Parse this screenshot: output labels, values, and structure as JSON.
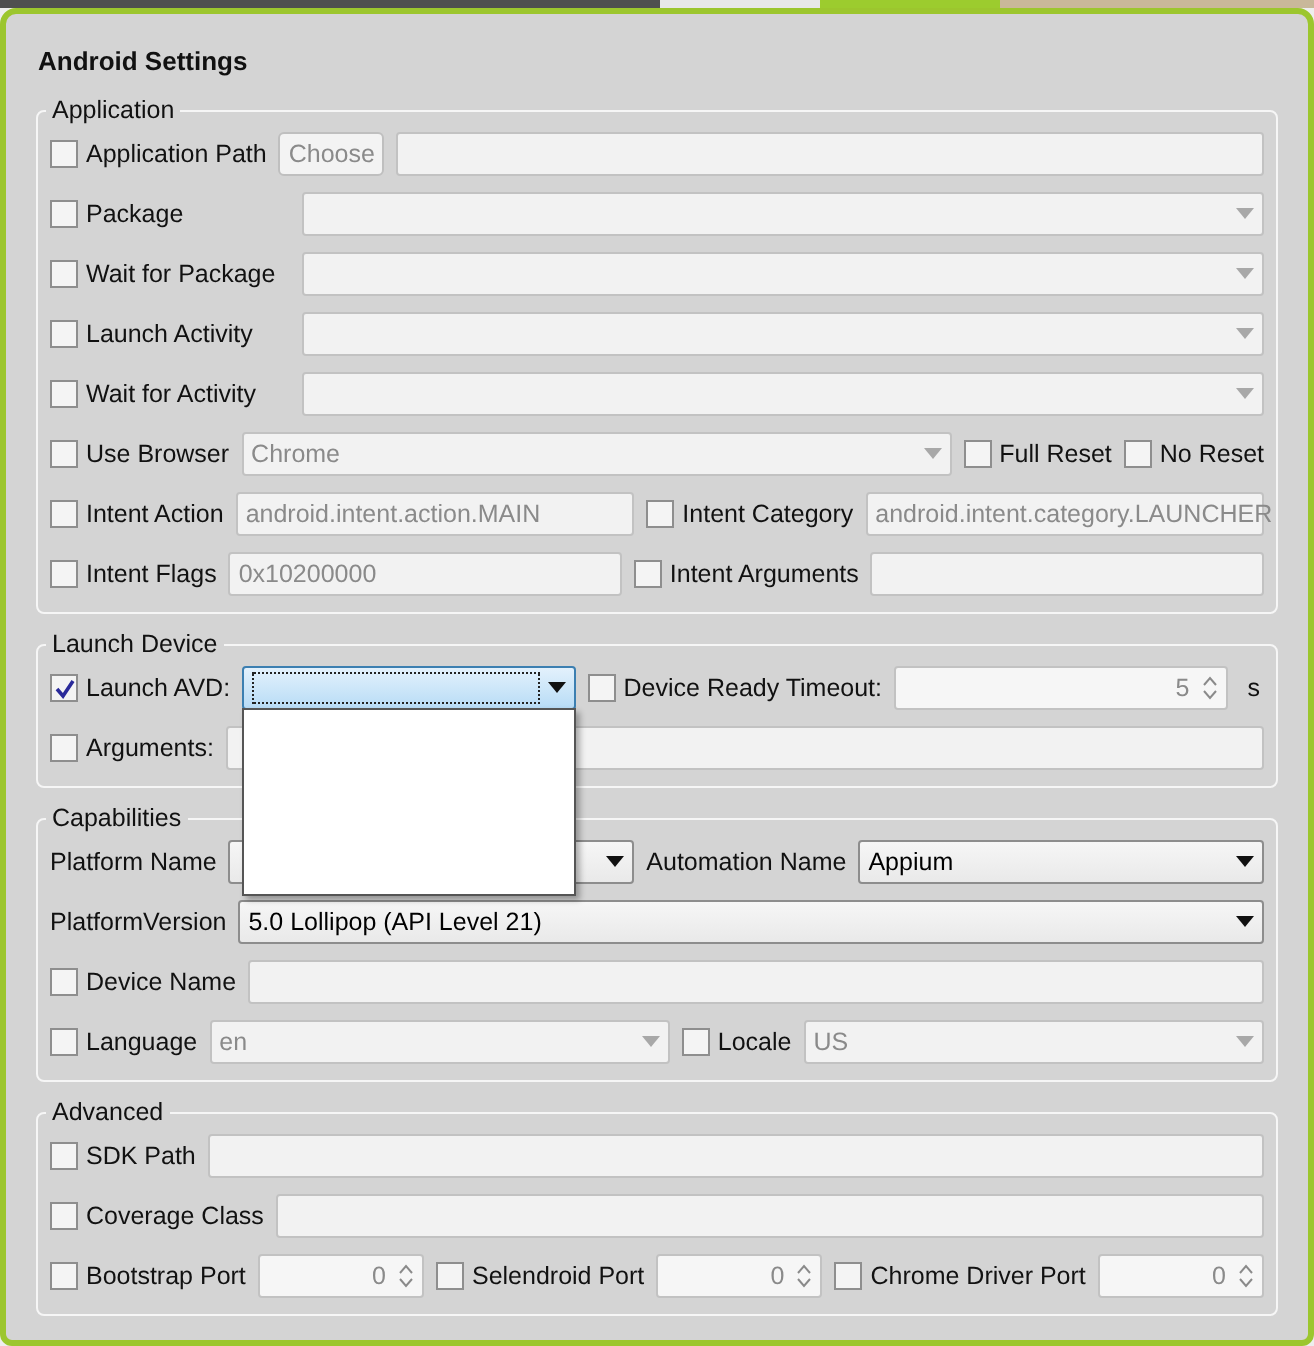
{
  "window": {
    "title": "Android Settings"
  },
  "sections": [
    {
      "title": "Application",
      "rows": [
        {
          "items": [
            {
              "kind": "checkbox",
              "label": "Application Path",
              "checked": false
            },
            {
              "kind": "button",
              "label": "Choose",
              "disabled": true
            },
            {
              "kind": "text",
              "disabled": true
            }
          ]
        },
        {
          "items": [
            {
              "kind": "checkbox",
              "label": "Package",
              "checked": false
            },
            {
              "kind": "combo",
              "disabled": true,
              "expanded": false
            }
          ]
        },
        {
          "items": [
            {
              "kind": "checkbox",
              "label": "Wait for Package",
              "checked": false
            },
            {
              "kind": "combo",
              "disabled": true,
              "expanded": false
            }
          ]
        },
        {
          "items": [
            {
              "kind": "checkbox",
              "label": "Launch Activity",
              "checked": false
            },
            {
              "kind": "combo",
              "disabled": true,
              "expanded": false
            }
          ]
        },
        {
          "items": [
            {
              "kind": "checkbox",
              "label": "Wait for Activity",
              "checked": false
            },
            {
              "kind": "combo",
              "disabled": true,
              "expanded": false
            }
          ]
        },
        {
          "items": [
            {
              "kind": "checkbox",
              "label": "Use Browser",
              "checked": false
            },
            {
              "kind": "combo",
              "value": "Chrome",
              "disabled": true,
              "expanded": false
            },
            {
              "kind": "checkbox",
              "label": "Full Reset",
              "checked": false
            },
            {
              "kind": "checkbox",
              "label": "No Reset",
              "checked": false
            }
          ]
        },
        {
          "items": [
            {
              "kind": "checkbox",
              "label": "Intent Action",
              "checked": false
            },
            {
              "kind": "text",
              "value": "android.intent.action.MAIN",
              "disabled": true
            },
            {
              "kind": "checkbox",
              "label": "Intent Category",
              "checked": false
            },
            {
              "kind": "text",
              "value": "android.intent.category.LAUNCHER",
              "disabled": true
            }
          ]
        },
        {
          "items": [
            {
              "kind": "checkbox",
              "label": "Intent Flags",
              "checked": false
            },
            {
              "kind": "text",
              "value": "0x10200000",
              "disabled": true
            },
            {
              "kind": "checkbox",
              "label": "Intent Arguments",
              "checked": false
            },
            {
              "kind": "text",
              "disabled": true
            }
          ]
        }
      ]
    },
    {
      "title": "Launch Device",
      "rows": [
        {
          "items": [
            {
              "kind": "checkbox",
              "label": "Launch AVD:",
              "checked": true
            },
            {
              "kind": "combo",
              "disabled": false,
              "expanded": true
            },
            {
              "kind": "checkbox",
              "label": "Device Ready Timeout:",
              "checked": false
            },
            {
              "kind": "spinner",
              "value": "5",
              "disabled": true
            },
            {
              "kind": "unit",
              "text": "s"
            }
          ]
        },
        {
          "items": [
            {
              "kind": "checkbox",
              "label": "Arguments:",
              "checked": false
            },
            {
              "kind": "text",
              "disabled": true
            }
          ]
        }
      ]
    },
    {
      "title": "Capabilities",
      "rows": [
        {
          "items": [
            {
              "kind": "label",
              "text": "Platform Name"
            },
            {
              "kind": "combo",
              "disabled": false,
              "expanded": false
            },
            {
              "kind": "label",
              "text": "Automation Name"
            },
            {
              "kind": "combo",
              "value": "Appium",
              "disabled": false,
              "expanded": false
            }
          ]
        },
        {
          "items": [
            {
              "kind": "label",
              "text": "PlatformVersion"
            },
            {
              "kind": "combo",
              "value": "5.0 Lollipop (API Level 21)",
              "disabled": false,
              "expanded": false
            }
          ]
        },
        {
          "items": [
            {
              "kind": "checkbox",
              "label": "Device Name",
              "checked": false
            },
            {
              "kind": "text",
              "disabled": true
            }
          ]
        },
        {
          "items": [
            {
              "kind": "checkbox",
              "label": "Language",
              "checked": false
            },
            {
              "kind": "combo",
              "value": "en",
              "disabled": true,
              "expanded": false
            },
            {
              "kind": "checkbox",
              "label": "Locale",
              "checked": false
            },
            {
              "kind": "combo",
              "value": "US",
              "disabled": true,
              "expanded": false
            }
          ]
        }
      ]
    },
    {
      "title": "Advanced",
      "rows": [
        {
          "items": [
            {
              "kind": "checkbox",
              "label": "SDK Path",
              "checked": false
            },
            {
              "kind": "text",
              "disabled": true
            }
          ]
        },
        {
          "items": [
            {
              "kind": "checkbox",
              "label": "Coverage Class",
              "checked": false
            },
            {
              "kind": "text",
              "disabled": true
            }
          ]
        },
        {
          "items": [
            {
              "kind": "checkbox",
              "label": "Bootstrap Port",
              "checked": false
            },
            {
              "kind": "spinner",
              "value": "0",
              "disabled": true
            },
            {
              "kind": "checkbox",
              "label": "Selendroid Port",
              "checked": false
            },
            {
              "kind": "spinner",
              "value": "0",
              "disabled": true
            },
            {
              "kind": "checkbox",
              "label": "Chrome Driver Port",
              "checked": false
            },
            {
              "kind": "spinner",
              "value": "0",
              "disabled": true
            }
          ]
        }
      ]
    }
  ]
}
